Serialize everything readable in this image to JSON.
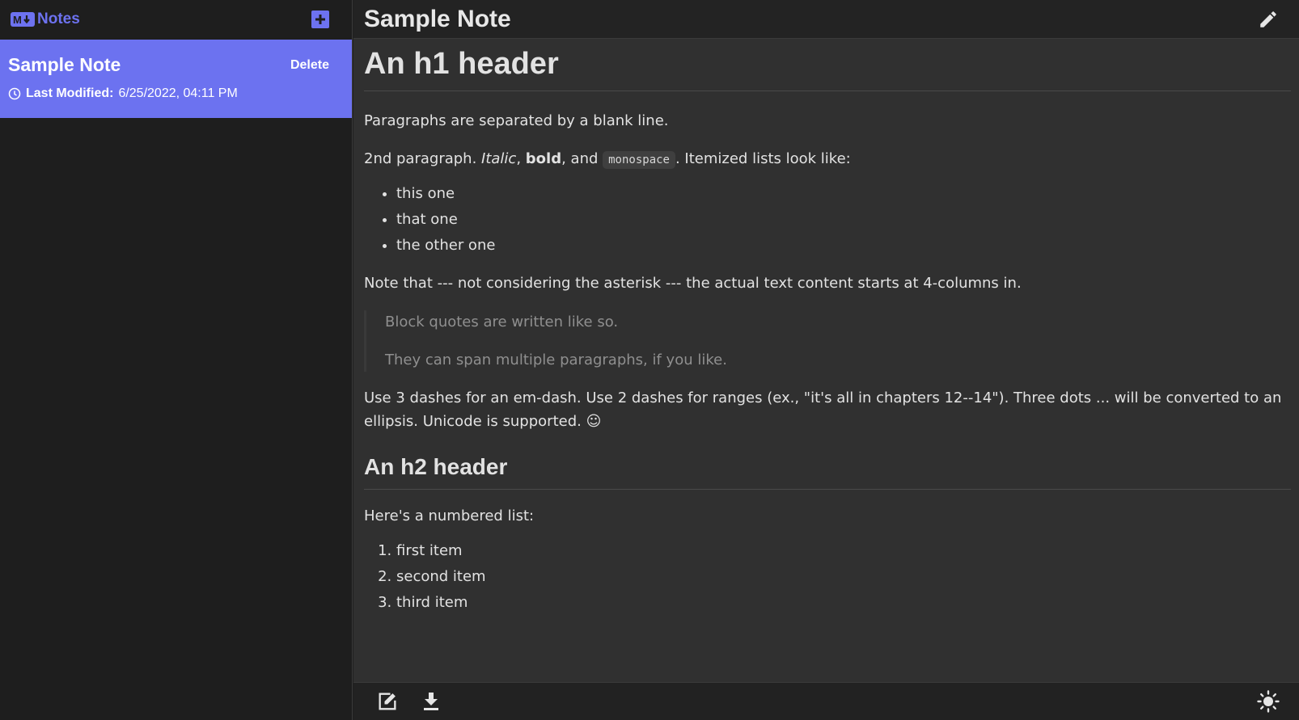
{
  "sidebar": {
    "brand": {
      "badge": "M↓",
      "label": "Notes"
    },
    "add_icon": "plus-square-icon",
    "notes": [
      {
        "title": "Sample Note",
        "delete_label": "Delete",
        "modified_label": "Last Modified:",
        "modified_value": "6/25/2022, 04:11 PM",
        "selected": true
      }
    ]
  },
  "topbar": {
    "title": "Sample Note",
    "edit_icon": "pencil-icon"
  },
  "content": {
    "h1": "An h1 header",
    "p1": "Paragraphs are separated by a blank line.",
    "p2": {
      "prefix": "2nd paragraph. ",
      "italic": "Italic",
      "sep1": ", ",
      "bold": "bold",
      "sep2": ", and ",
      "code": "monospace",
      "suffix": ". Itemized lists look like:"
    },
    "bullets": [
      "this one",
      "that one",
      "the other one"
    ],
    "p3": "Note that --- not considering the asterisk --- the actual text content starts at 4-columns in.",
    "quote": [
      "Block quotes are written like so.",
      "They can span multiple paragraphs, if you like."
    ],
    "p4": "Use 3 dashes for an em-dash. Use 2 dashes for ranges (ex., \"it's all in chapters 12--14\"). Three dots ... will be converted to an ellipsis. Unicode is supported. ☺",
    "h2": "An h2 header",
    "p5": "Here's a numbered list:",
    "numbered": [
      "first item",
      "second item",
      "third item"
    ]
  },
  "bottombar": {
    "icons": [
      "edit-note-icon",
      "download-icon",
      "theme-sun-icon"
    ]
  },
  "colors": {
    "accent": "#6c72f0",
    "sidebar_bg": "#1e1e1e",
    "main_bg": "#303030",
    "bar_bg": "#232323"
  }
}
